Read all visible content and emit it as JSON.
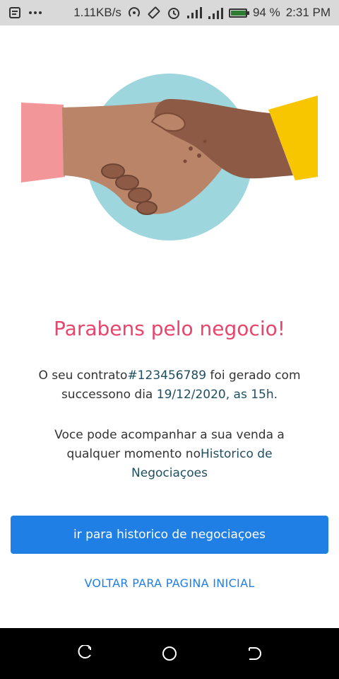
{
  "status_bar": {
    "network_speed": "1.11KB/s",
    "battery_percent": "94 %",
    "battery_level": 0.94,
    "time": "2:31 PM",
    "icons": [
      "notes-icon",
      "more-icon",
      "hotspot-icon",
      "rotate-icon",
      "alarm-icon",
      "signal-icon",
      "signal-data-icon",
      "battery-icon"
    ]
  },
  "illustration": {
    "name": "handshake",
    "colors": {
      "circle": "#9dd6dc",
      "left_sleeve": "#f2969a",
      "right_sleeve": "#f7c600",
      "hand": "#b98468",
      "hand_dark": "#8c5a45"
    }
  },
  "content": {
    "title": "Parabens pelo negocio!",
    "contract_prefix": "O seu contrato",
    "contract_number": "#123456789",
    "contract_suffix": " foi gerado com successono dia ",
    "contract_date": "19/12/2020, as 15h.",
    "tracking_prefix": "Voce pode acompanhar a sua venda a qualquer momento no",
    "tracking_link": "Historico de Negociaçoes"
  },
  "actions": {
    "primary_label": "ir para historico de negociaçoes",
    "secondary_label": "VOLTAR PARA PAGINA INICIAL"
  },
  "nav_bar": {
    "buttons": [
      "recent-apps-icon",
      "home-icon",
      "back-icon"
    ]
  },
  "colors": {
    "title": "#e9456c",
    "primary": "#1f7fe5",
    "highlight": "#1f4e5f"
  }
}
